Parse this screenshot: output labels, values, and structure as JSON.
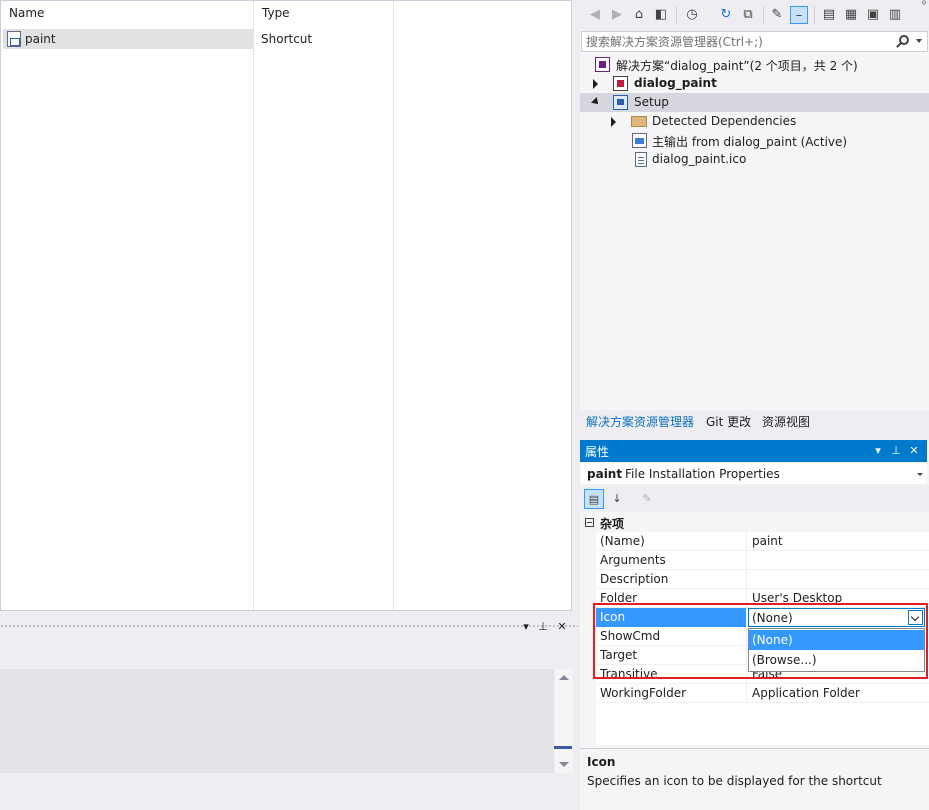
{
  "file_list": {
    "columns": [
      "Name",
      "Type"
    ],
    "rows": [
      {
        "name": "paint",
        "type": "Shortcut",
        "icon": "shortcut-file-icon"
      }
    ]
  },
  "bottom_panel": {
    "buttons": [
      "▾",
      "⊥",
      "✕"
    ]
  },
  "solution_explorer": {
    "toolbar_overflow": "⁰",
    "search_placeholder": "搜索解决方案资源管理器(Ctrl+;)",
    "tree": [
      {
        "label": "解决方案“dialog_paint”(2 个项目，共 2 个)",
        "icon": "solution-icon",
        "level": 0,
        "expander": "none",
        "bold": false
      },
      {
        "label": "dialog_paint",
        "icon": "cpp-project-icon",
        "level": 0,
        "expander": "collapsed",
        "bold": true
      },
      {
        "label": "Setup",
        "icon": "setup-project-icon",
        "level": 0,
        "expander": "expanded",
        "bold": false,
        "selected": true
      },
      {
        "label": "Detected Dependencies",
        "icon": "folder-icon",
        "level": 1,
        "expander": "collapsed",
        "bold": false
      },
      {
        "label": "主输出 from dialog_paint (Active)",
        "icon": "primary-output-icon",
        "level": 1,
        "expander": "none",
        "bold": false
      },
      {
        "label": "dialog_paint.ico",
        "icon": "file-icon",
        "level": 1,
        "expander": "none",
        "bold": false
      }
    ],
    "tabs": [
      "解决方案资源管理器",
      "Git 更改",
      "资源视图"
    ],
    "active_tab": 0
  },
  "properties": {
    "title": "属性",
    "title_buttons": [
      "▾",
      "⊥",
      "✕"
    ],
    "object_name": "paint",
    "object_type": "File Installation Properties",
    "category": "杂项",
    "rows": [
      {
        "name": "(Name)",
        "value": "paint"
      },
      {
        "name": "Arguments",
        "value": ""
      },
      {
        "name": "Description",
        "value": ""
      },
      {
        "name": "Folder",
        "value": "User's Desktop"
      },
      {
        "name": "Icon",
        "value": "(None)",
        "selected": true
      },
      {
        "name": "ShowCmd",
        "value": ""
      },
      {
        "name": "Target",
        "value": ""
      },
      {
        "name": "Transitive",
        "value": "False"
      },
      {
        "name": "WorkingFolder",
        "value": "Application Folder"
      }
    ],
    "icon_dropdown": {
      "value": "(None)",
      "options": [
        "(None)",
        "(Browse...)"
      ],
      "selected_index": 0
    },
    "description": {
      "title": "Icon",
      "text": "Specifies an icon to be displayed for the shortcut"
    }
  },
  "colors": {
    "accent": "#007acc",
    "selection": "#3399ff",
    "highlight_border": "#e51c23"
  }
}
